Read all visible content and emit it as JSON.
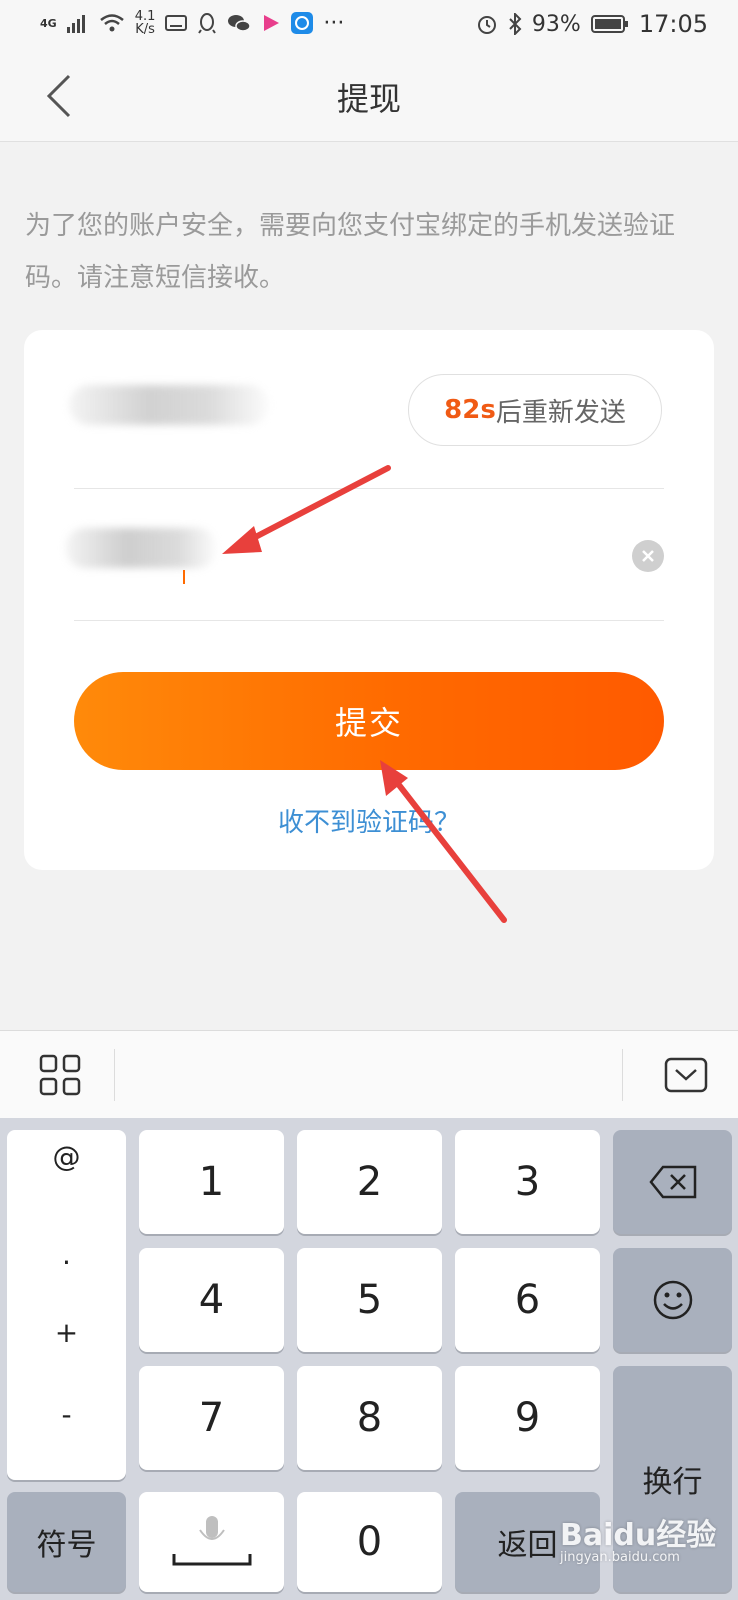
{
  "status_bar": {
    "network": "4G",
    "speed_value": "4.1",
    "speed_unit": "K/s",
    "battery": "93%",
    "time": "17:05",
    "icons": [
      "signal-icon",
      "wifi-icon",
      "keyboard-icon",
      "qq-icon",
      "wechat-icon",
      "video-icon",
      "app-icon",
      "more-icon",
      "alarm-icon",
      "bluetooth-icon",
      "battery-icon"
    ]
  },
  "nav": {
    "title": "提现"
  },
  "notice": "为了您的账户安全，需要向您支付宝绑定的手机发送验证码。请注意短信接收。",
  "form": {
    "resend_count": "82s",
    "resend_suffix": "后重新发送",
    "submit_label": "提交",
    "help_link": "收不到验证码？"
  },
  "keyboard": {
    "symbols": [
      "@",
      ".",
      "+",
      "-"
    ],
    "digits": [
      "1",
      "2",
      "3",
      "4",
      "5",
      "6",
      "7",
      "8",
      "9",
      "0"
    ],
    "fn_label": "符号",
    "return_label": "返回",
    "enter_label": "换行"
  },
  "watermark": {
    "brand": "Baidu经验",
    "url": "jingyan.baidu.com"
  },
  "colors": {
    "accent_orange": "#ff6a00",
    "countdown": "#f05a14",
    "link_blue": "#3d8fd4",
    "annotation_red": "#e8403c"
  }
}
